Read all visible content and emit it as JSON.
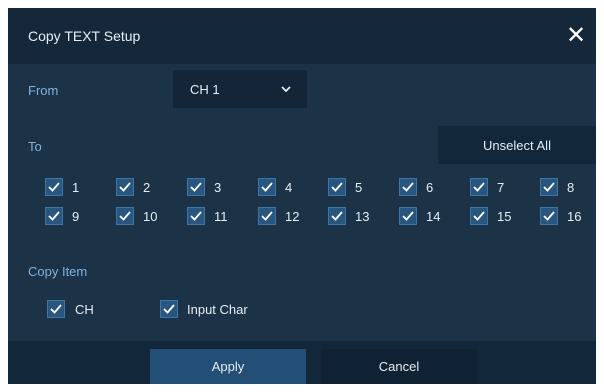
{
  "dialog": {
    "title": "Copy TEXT Setup",
    "close_icon": "close-icon"
  },
  "from": {
    "label": "From",
    "selected": "CH 1"
  },
  "to": {
    "label": "To",
    "unselect_all": "Unselect All",
    "channels": [
      {
        "label": "1",
        "checked": true
      },
      {
        "label": "2",
        "checked": true
      },
      {
        "label": "3",
        "checked": true
      },
      {
        "label": "4",
        "checked": true
      },
      {
        "label": "5",
        "checked": true
      },
      {
        "label": "6",
        "checked": true
      },
      {
        "label": "7",
        "checked": true
      },
      {
        "label": "8",
        "checked": true
      },
      {
        "label": "9",
        "checked": true
      },
      {
        "label": "10",
        "checked": true
      },
      {
        "label": "11",
        "checked": true
      },
      {
        "label": "12",
        "checked": true
      },
      {
        "label": "13",
        "checked": true
      },
      {
        "label": "14",
        "checked": true
      },
      {
        "label": "15",
        "checked": true
      },
      {
        "label": "16",
        "checked": true
      }
    ]
  },
  "copy_item": {
    "label": "Copy Item",
    "items": [
      {
        "label": "CH",
        "checked": true
      },
      {
        "label": "Input Char",
        "checked": true
      }
    ]
  },
  "buttons": {
    "apply": "Apply",
    "cancel": "Cancel"
  },
  "colors": {
    "panel": "#1b3247",
    "titlebar": "#14283a",
    "label_blue": "#7fb3df",
    "checkbox": "#29567e",
    "checkmark": "#ffffff",
    "apply": "#234f76",
    "cancel": "#0f2233"
  }
}
